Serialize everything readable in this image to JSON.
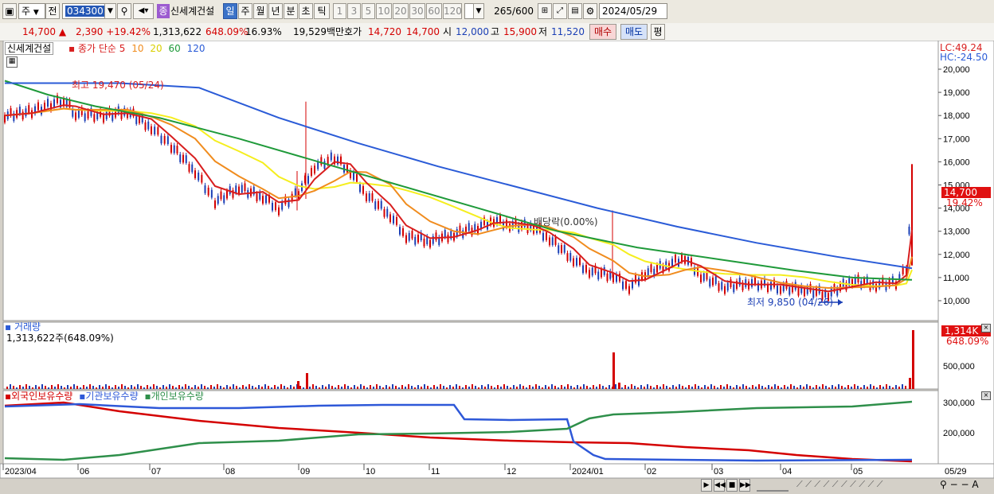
{
  "toolbar": {
    "market_type": "주",
    "prev_label": "전",
    "stock_code": "034300",
    "stock_name": "신세계건설",
    "jong_badge": "종",
    "periods": [
      "일",
      "주",
      "월",
      "년",
      "분",
      "초",
      "틱"
    ],
    "active_period": "일",
    "intervals": [
      "1",
      "3",
      "5",
      "10",
      "20",
      "30",
      "60",
      "120"
    ],
    "count_current": "265",
    "count_max": "/600",
    "date": "2024/05/29"
  },
  "quote": {
    "price": "14,700",
    "change": "2,390",
    "change_pct": "+19.42%",
    "volume": "1,313,622",
    "volume_ratio": "648.09%",
    "turnover_pct": "16.93%",
    "trade_value": "19,529백만",
    "hoga_label": "호가",
    "hoga_ask": "14,720",
    "hoga_bid": "14,700",
    "open_label": "시",
    "open": "12,000",
    "high_label": "고",
    "high": "15,900",
    "low_label": "저",
    "low": "11,520",
    "buy_label": "매수",
    "sell_label": "매도",
    "eval_label": "평"
  },
  "chart": {
    "price_panel": {
      "stock_name": "신세계건설",
      "ma_label": "종가 단순",
      "ma_periods": [
        "5",
        "10",
        "20",
        "60",
        "120"
      ],
      "ma_colors": [
        "#d81e1e",
        "#f08c1e",
        "#f5ee1e",
        "#1f9a3a",
        "#2a5bd7"
      ],
      "lc": "LC:49.24",
      "hc": "HC:-24.50",
      "y_ticks": [
        "20,000",
        "19,000",
        "18,000",
        "17,000",
        "16,000",
        "15,000",
        "14,000",
        "13,000",
        "12,000",
        "11,000",
        "10,000"
      ],
      "current_price_tag": "14,700",
      "current_pct_tag": "19.42%",
      "high_annotation": "최고 19,470 (05/24)",
      "low_annotation": "최저 9,850 (04/26)",
      "mid_annotation": "배당락(0.00%)"
    },
    "volume_panel": {
      "title": "거래량",
      "value": "1,313,622주(648.09%)",
      "tag_value": "1,314K",
      "tag_pct": "648.09%",
      "y_tick": "500,000"
    },
    "holding_panel": {
      "series_names": [
        "외국인보유수량",
        "기관보유수량",
        "개인보유수량"
      ],
      "series_colors": [
        "#d40000",
        "#2e58d8",
        "#2e8f4a"
      ],
      "y_ticks": [
        "300,000",
        "200,000"
      ]
    },
    "x_labels": [
      "2023/04",
      "06",
      "07",
      "08",
      "09",
      "10",
      "11",
      "12",
      "2024/01",
      "02",
      "03",
      "04",
      "05"
    ],
    "x_end_label": "05/29"
  }
}
